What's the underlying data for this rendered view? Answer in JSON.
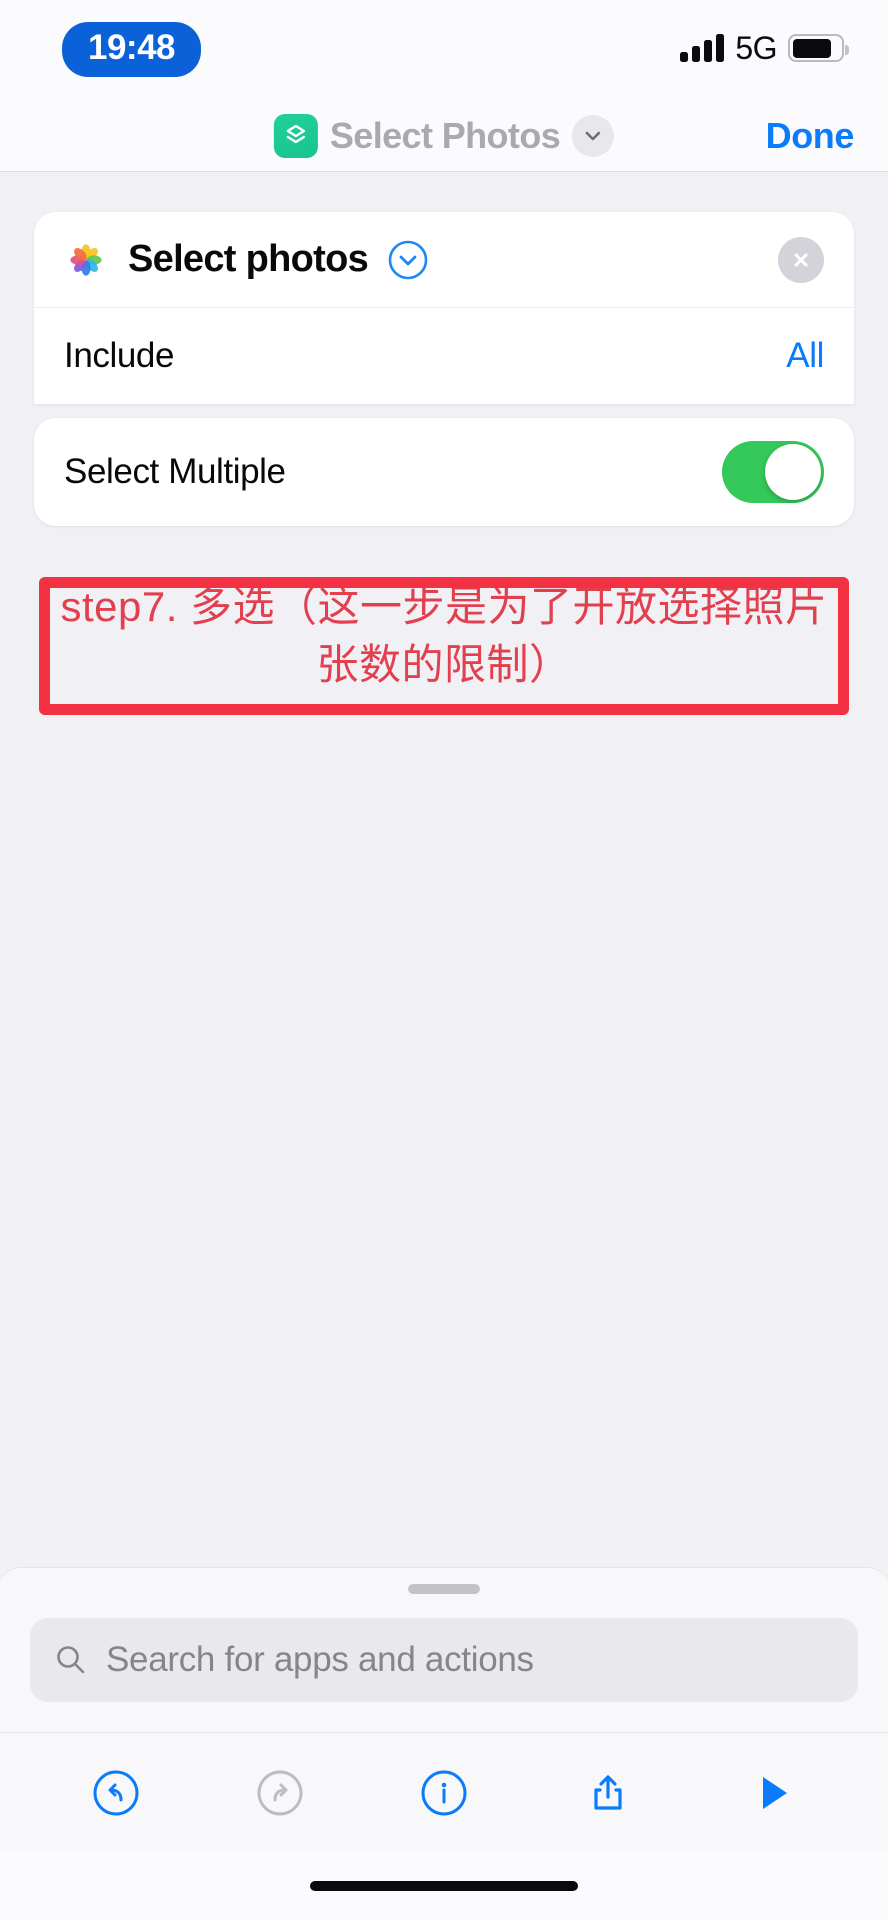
{
  "status_bar": {
    "time": "19:48",
    "network": "5G",
    "signal_bars": 4,
    "battery_level_pct": 82,
    "time_pill_color": "#0b61d8"
  },
  "nav_bar": {
    "app_icon_name": "shortcuts-app-icon",
    "title": "Select Photos",
    "chevron_icon": "chevron-down-icon",
    "done_label": "Done",
    "done_color": "#0a7cfb"
  },
  "action_card": {
    "app_icon_name": "photos-app-icon",
    "title": "Select photos",
    "expand_icon": "chevron-down-circle-icon",
    "close_icon": "close-circle-icon",
    "parameters": [
      {
        "label": "Include",
        "value": "All"
      }
    ],
    "toggle_row": {
      "label": "Select Multiple",
      "state": "on",
      "on_color": "#34c759"
    }
  },
  "annotation": {
    "text": "step7. 多选（这一步是为了开放选择照片张数的限制）",
    "color": "#e2404f",
    "highlight_color": "#f23142"
  },
  "search": {
    "placeholder": "Search for apps and actions",
    "icon": "search-icon"
  },
  "toolbar": {
    "items": [
      {
        "name": "undo-icon",
        "label": "Undo",
        "enabled": true
      },
      {
        "name": "redo-icon",
        "label": "Redo",
        "enabled": false
      },
      {
        "name": "info-icon",
        "label": "Info",
        "enabled": true
      },
      {
        "name": "share-icon",
        "label": "Share",
        "enabled": true
      },
      {
        "name": "play-icon",
        "label": "Run",
        "enabled": true
      }
    ]
  }
}
